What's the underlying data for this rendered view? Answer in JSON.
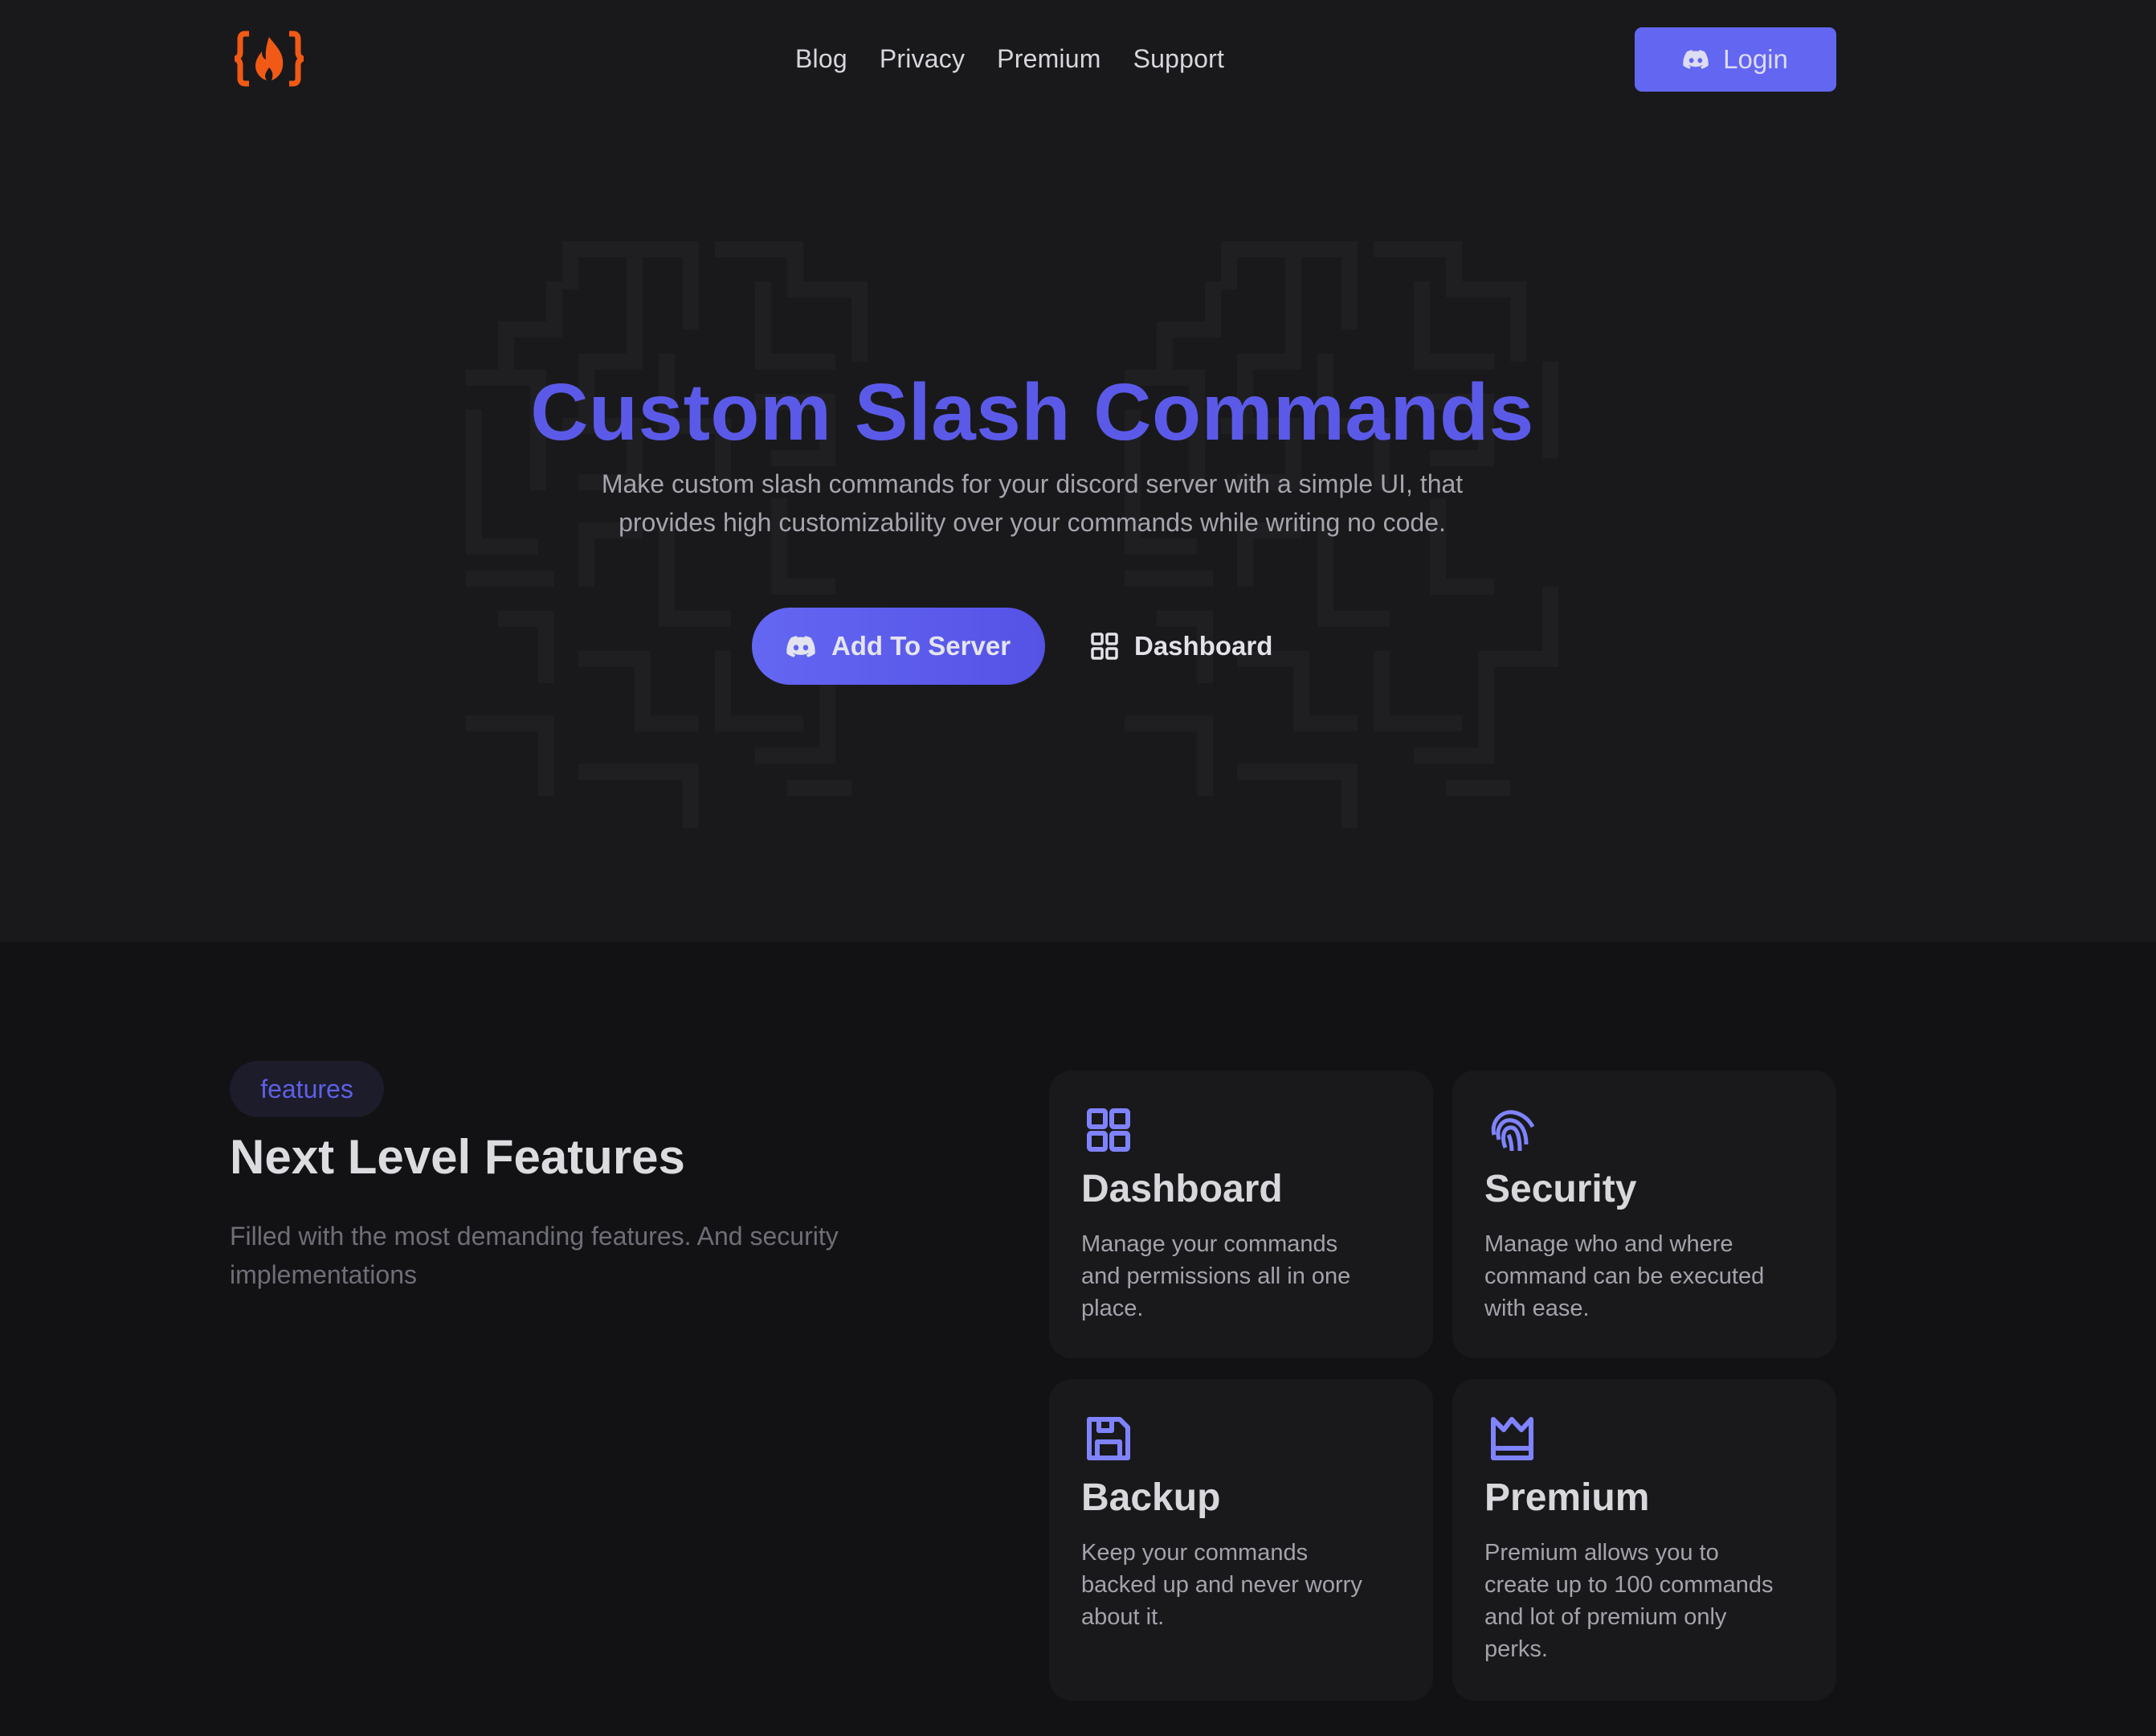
{
  "colors": {
    "accent": "#6366f1",
    "hero_title": "#5b5ae8",
    "logo": "#f15a16",
    "hero_bg": "#19191b",
    "page_bg": "#121214",
    "card_bg": "#19191b",
    "feature_icon": "#7f83ff"
  },
  "nav": {
    "logo_icon": "braces-fire-logo",
    "links": [
      {
        "label": "Blog"
      },
      {
        "label": "Privacy"
      },
      {
        "label": "Premium"
      },
      {
        "label": "Support"
      }
    ],
    "login": {
      "label": "Login",
      "icon": "discord-icon"
    }
  },
  "hero": {
    "title": "Custom Slash Commands",
    "subtitle_lines": [
      "Make custom slash commands for your discord server with a simple UI, that",
      "provides high customizability over your commands while writing no code."
    ],
    "primary_button": {
      "label": "Add To Server",
      "icon": "discord-icon"
    },
    "secondary_button": {
      "label": "Dashboard",
      "icon": "grid-icon"
    }
  },
  "features": {
    "badge": "features",
    "title": "Next Level Features",
    "description_lines": [
      "Filled with the most demanding features. And security",
      "implementations"
    ],
    "cards": [
      {
        "icon": "grid-icon",
        "title": "Dashboard",
        "desc_lines": [
          "Manage your commands",
          "and permissions all in one",
          "place."
        ]
      },
      {
        "icon": "fingerprint-icon",
        "title": "Security",
        "desc_lines": [
          "Manage who and where",
          "command can be executed",
          "with ease."
        ]
      },
      {
        "icon": "floppy-disk-icon",
        "title": "Backup",
        "desc_lines": [
          "Keep your commands",
          "backed up and never worry",
          "about it."
        ]
      },
      {
        "icon": "crown-icon",
        "title": "Premium",
        "desc_lines": [
          "Premium allows you to",
          "create up to 100 commands",
          "and lot of premium only",
          "perks."
        ]
      }
    ]
  }
}
